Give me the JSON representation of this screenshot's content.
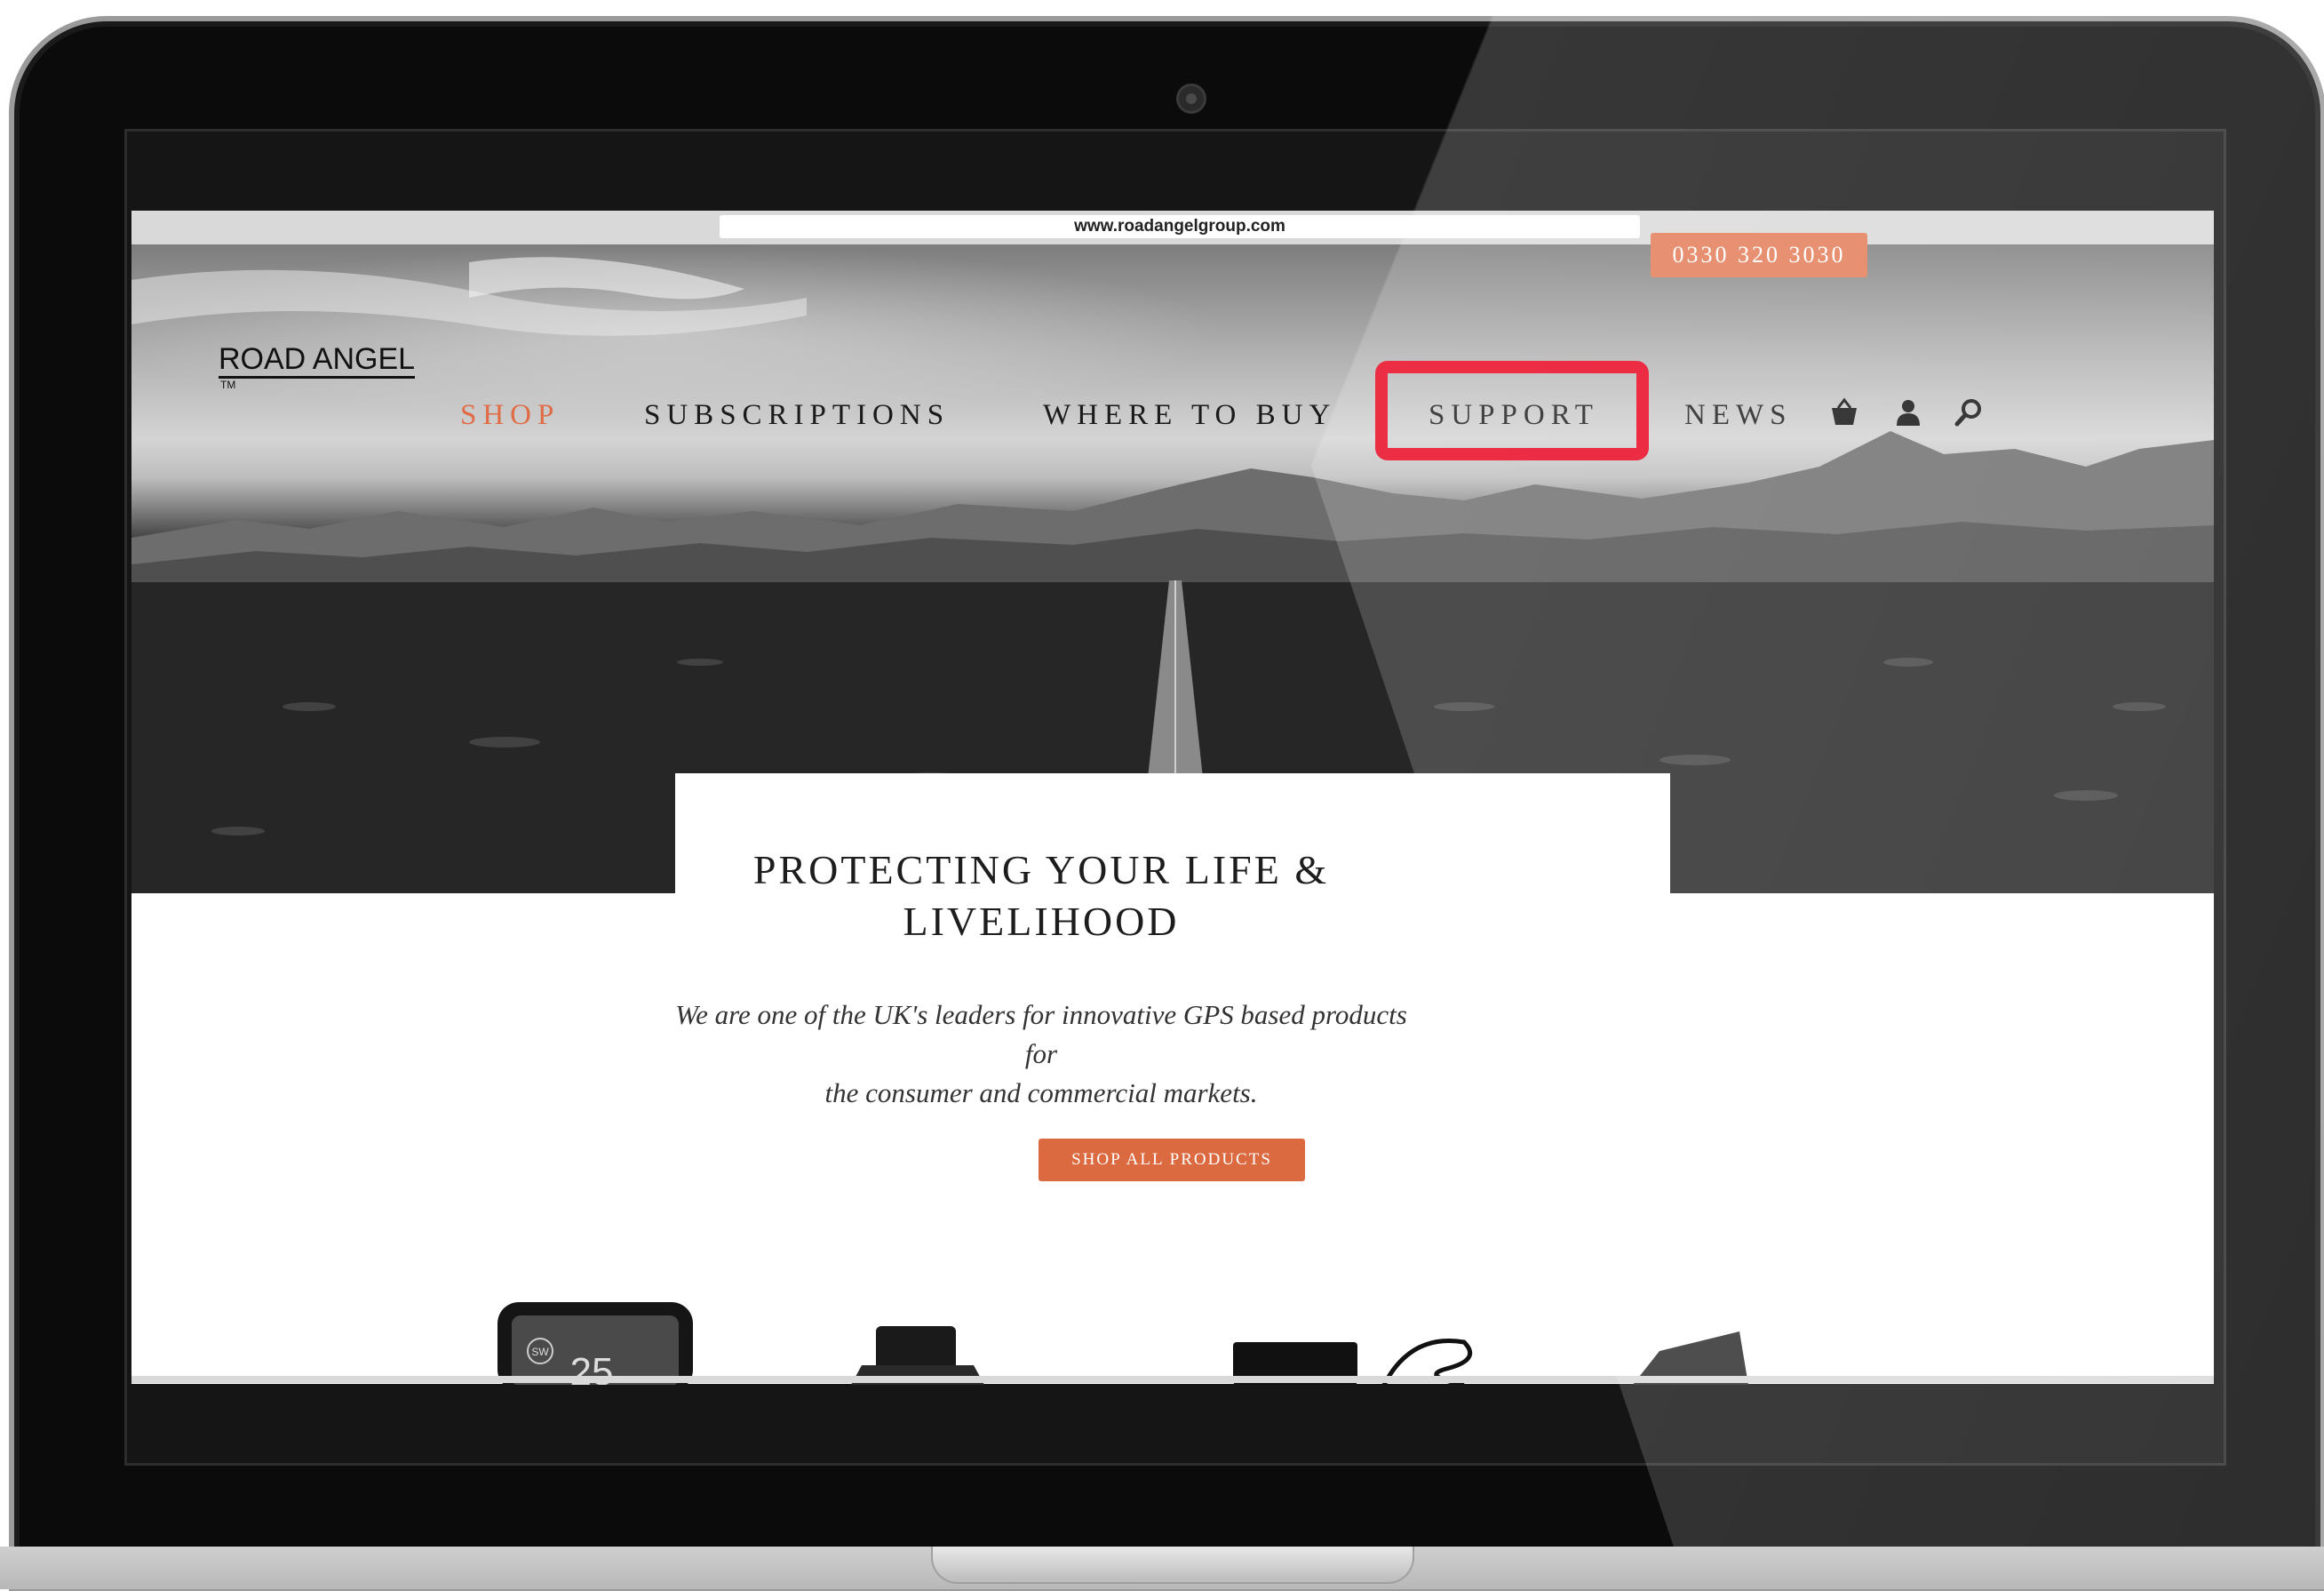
{
  "browser": {
    "url": "www.roadangelgroup.com"
  },
  "header": {
    "phone": "0330 320 3030",
    "logo_text": "ROAD ANGEL",
    "logo_tm": "TM"
  },
  "nav": {
    "items": [
      {
        "label": "SHOP",
        "active": true
      },
      {
        "label": "SUBSCRIPTIONS",
        "active": false
      },
      {
        "label": "WHERE TO BUY",
        "active": false
      },
      {
        "label": "SUPPORT",
        "active": false,
        "highlighted": true
      },
      {
        "label": "NEWS",
        "active": false
      }
    ],
    "icons": [
      "basket-icon",
      "user-icon",
      "search-icon"
    ]
  },
  "hero": {
    "headline_line1": "PROTECTING YOUR LIFE &",
    "headline_line2": "LIVELIHOOD",
    "tagline_line1": "We are one of the UK's leaders for innovative GPS based products for",
    "tagline_line2": "the consumer and commercial markets.",
    "cta_label": "SHOP ALL PRODUCTS"
  },
  "device_screen": {
    "speed_badge": "SW",
    "speed_value": "25"
  },
  "colors": {
    "accent": "#e06c45",
    "cta": "#dc6a41",
    "highlight": "#e8001c"
  }
}
